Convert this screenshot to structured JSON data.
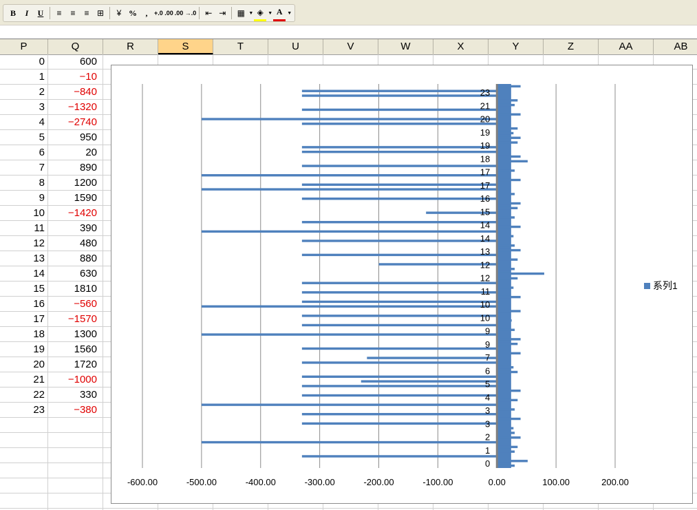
{
  "toolbar": {
    "buttons": [
      {
        "name": "bold-button",
        "label": "B",
        "cls": "bold"
      },
      {
        "name": "italic-button",
        "label": "I",
        "cls": "ital"
      },
      {
        "name": "underline-button",
        "label": "U",
        "cls": "und"
      },
      {
        "name": "align-left-icon",
        "label": "≡",
        "cls": ""
      },
      {
        "name": "align-center-icon",
        "label": "≡",
        "cls": ""
      },
      {
        "name": "align-right-icon",
        "label": "≡",
        "cls": ""
      },
      {
        "name": "merge-center-icon",
        "label": "⊞",
        "cls": ""
      },
      {
        "name": "currency-icon",
        "label": "¥",
        "cls": ""
      },
      {
        "name": "percent-button",
        "label": "%",
        "cls": "bold"
      },
      {
        "name": "comma-style-button",
        "label": ",",
        "cls": "bold"
      },
      {
        "name": "increase-decimal-button",
        "label": "+.0 .00",
        "cls": "small"
      },
      {
        "name": "decrease-decimal-button",
        "label": ".00 →.0",
        "cls": "small"
      },
      {
        "name": "decrease-indent-icon",
        "label": "⇤",
        "cls": ""
      },
      {
        "name": "increase-indent-icon",
        "label": "⇥",
        "cls": ""
      },
      {
        "name": "borders-icon",
        "label": "▦",
        "cls": ""
      },
      {
        "name": "fill-color-icon",
        "label": "◈",
        "cls": ""
      },
      {
        "name": "font-color-icon",
        "label": "A",
        "cls": "bold"
      }
    ]
  },
  "columns": [
    "P",
    "Q",
    "R",
    "S",
    "T",
    "U",
    "V",
    "W",
    "X",
    "Y",
    "Z",
    "AA",
    "AB"
  ],
  "selected_column": "S",
  "rows": [
    {
      "p": "0",
      "q": "600",
      "neg": false
    },
    {
      "p": "1",
      "q": "−10",
      "neg": true
    },
    {
      "p": "2",
      "q": "−840",
      "neg": true
    },
    {
      "p": "3",
      "q": "−1320",
      "neg": true
    },
    {
      "p": "4",
      "q": "−2740",
      "neg": true
    },
    {
      "p": "5",
      "q": "950",
      "neg": false
    },
    {
      "p": "6",
      "q": "20",
      "neg": false
    },
    {
      "p": "7",
      "q": "890",
      "neg": false
    },
    {
      "p": "8",
      "q": "1200",
      "neg": false
    },
    {
      "p": "9",
      "q": "1590",
      "neg": false
    },
    {
      "p": "10",
      "q": "−1420",
      "neg": true
    },
    {
      "p": "11",
      "q": "390",
      "neg": false
    },
    {
      "p": "12",
      "q": "480",
      "neg": false
    },
    {
      "p": "13",
      "q": "880",
      "neg": false
    },
    {
      "p": "14",
      "q": "630",
      "neg": false
    },
    {
      "p": "15",
      "q": "1810",
      "neg": false
    },
    {
      "p": "16",
      "q": "−560",
      "neg": true
    },
    {
      "p": "17",
      "q": "−1570",
      "neg": true
    },
    {
      "p": "18",
      "q": "1300",
      "neg": false
    },
    {
      "p": "19",
      "q": "1560",
      "neg": false
    },
    {
      "p": "20",
      "q": "1720",
      "neg": false
    },
    {
      "p": "21",
      "q": "−1000",
      "neg": true
    },
    {
      "p": "22",
      "q": "330",
      "neg": false
    },
    {
      "p": "23",
      "q": "−380",
      "neg": true
    }
  ],
  "chart_data": {
    "type": "bar",
    "orientation": "horizontal",
    "x_ticks": [
      "-600.00",
      "-500.00",
      "-400.00",
      "-300.00",
      "-200.00",
      "-100.00",
      "0.00",
      "100.00",
      "200.00"
    ],
    "xlim": [
      -600,
      200
    ],
    "categories": [
      "0",
      "1",
      "2",
      "3",
      "3",
      "4",
      "5",
      "6",
      "7",
      "9",
      "9",
      "10",
      "10",
      "11",
      "12",
      "12",
      "13",
      "14",
      "14",
      "15",
      "16",
      "17",
      "17",
      "18",
      "19",
      "19",
      "20",
      "21",
      "23"
    ],
    "series": [
      {
        "name": "系列1",
        "color": "#4f81bd",
        "values": [
          30,
          52,
          -330,
          30,
          35,
          -500,
          40,
          30,
          28,
          -330,
          40,
          -330,
          30,
          -500,
          35,
          -330,
          40,
          -330,
          -230,
          -330,
          35,
          28,
          -330,
          -220,
          40,
          -330,
          35,
          40,
          -500,
          30,
          -330,
          25,
          -330,
          40,
          -500,
          -330,
          40,
          -330,
          28,
          -330,
          35,
          80,
          30,
          -200,
          35,
          -330,
          40,
          30,
          -330,
          28,
          -500,
          40,
          -330,
          30,
          -120,
          35,
          40,
          -330,
          30,
          -500,
          -330,
          40,
          -500,
          30,
          -330,
          52,
          40,
          -330,
          -330,
          35,
          40,
          28,
          35,
          -330,
          -500,
          40,
          -330,
          30,
          35,
          -330,
          -330,
          40
        ]
      }
    ],
    "legend": {
      "entries": [
        "系列1"
      ],
      "position": "right"
    }
  }
}
